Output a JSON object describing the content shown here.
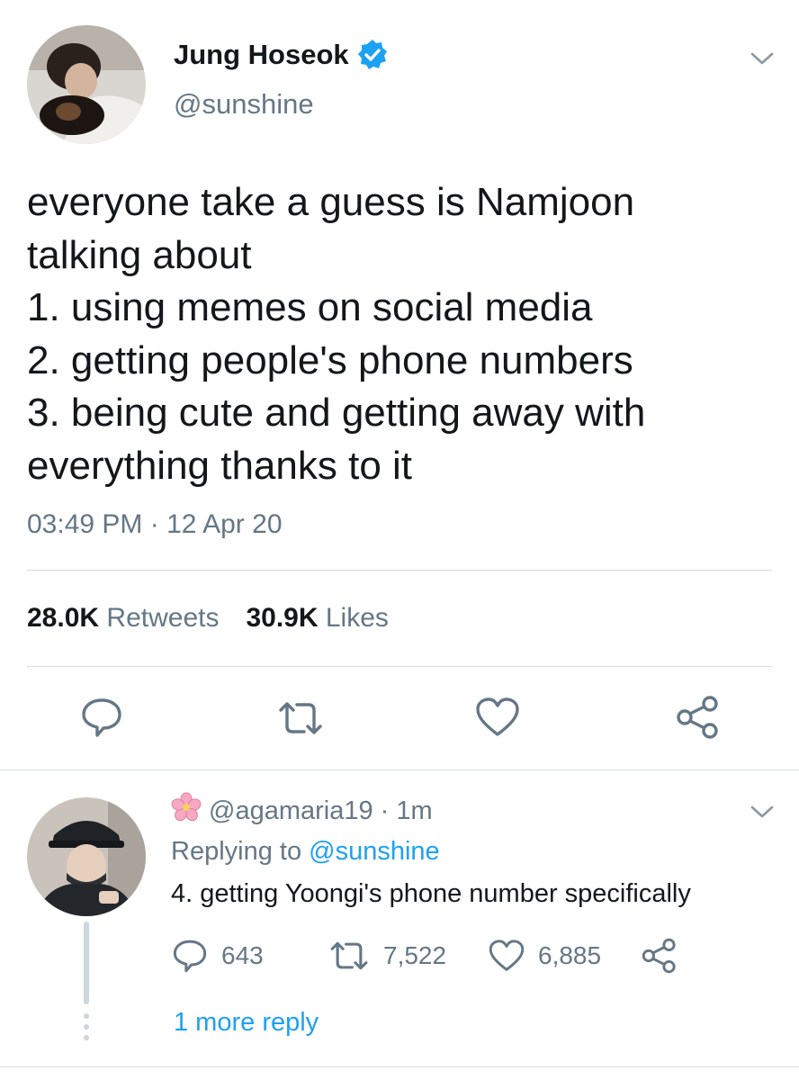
{
  "tweet": {
    "author_name": "Jung Hoseok",
    "author_handle": "@sunshine",
    "verified_icon": "verified-badge-icon",
    "text": "everyone take a guess is Namjoon\ntalking about\n1. using memes on social media\n2. getting people's phone numbers\n3. being cute and getting away with\neverything thanks to it",
    "timestamp": "03:49 PM · 12 Apr 20",
    "retweets_count": "28.0K",
    "retweets_label": "Retweets",
    "likes_count": "30.9K",
    "likes_label": "Likes",
    "actions": [
      "reply-icon",
      "retweet-icon",
      "like-icon",
      "share-icon"
    ]
  },
  "reply": {
    "flower_icon": "cherry-blossom-icon",
    "handle": "@agamaria19",
    "time": "· 1m",
    "replying_prefix": "Replying to",
    "replying_to": "@sunshine",
    "text": "4. getting Yoongi's phone number specifically",
    "reply_count": "643",
    "retweet_count": "7,522",
    "like_count": "6,885",
    "more_replies": "1 more reply"
  },
  "colors": {
    "accent": "#1da1f2",
    "text": "#14171a",
    "muted": "#657786",
    "divider": "#d5dbe0",
    "icon": "#657786"
  }
}
